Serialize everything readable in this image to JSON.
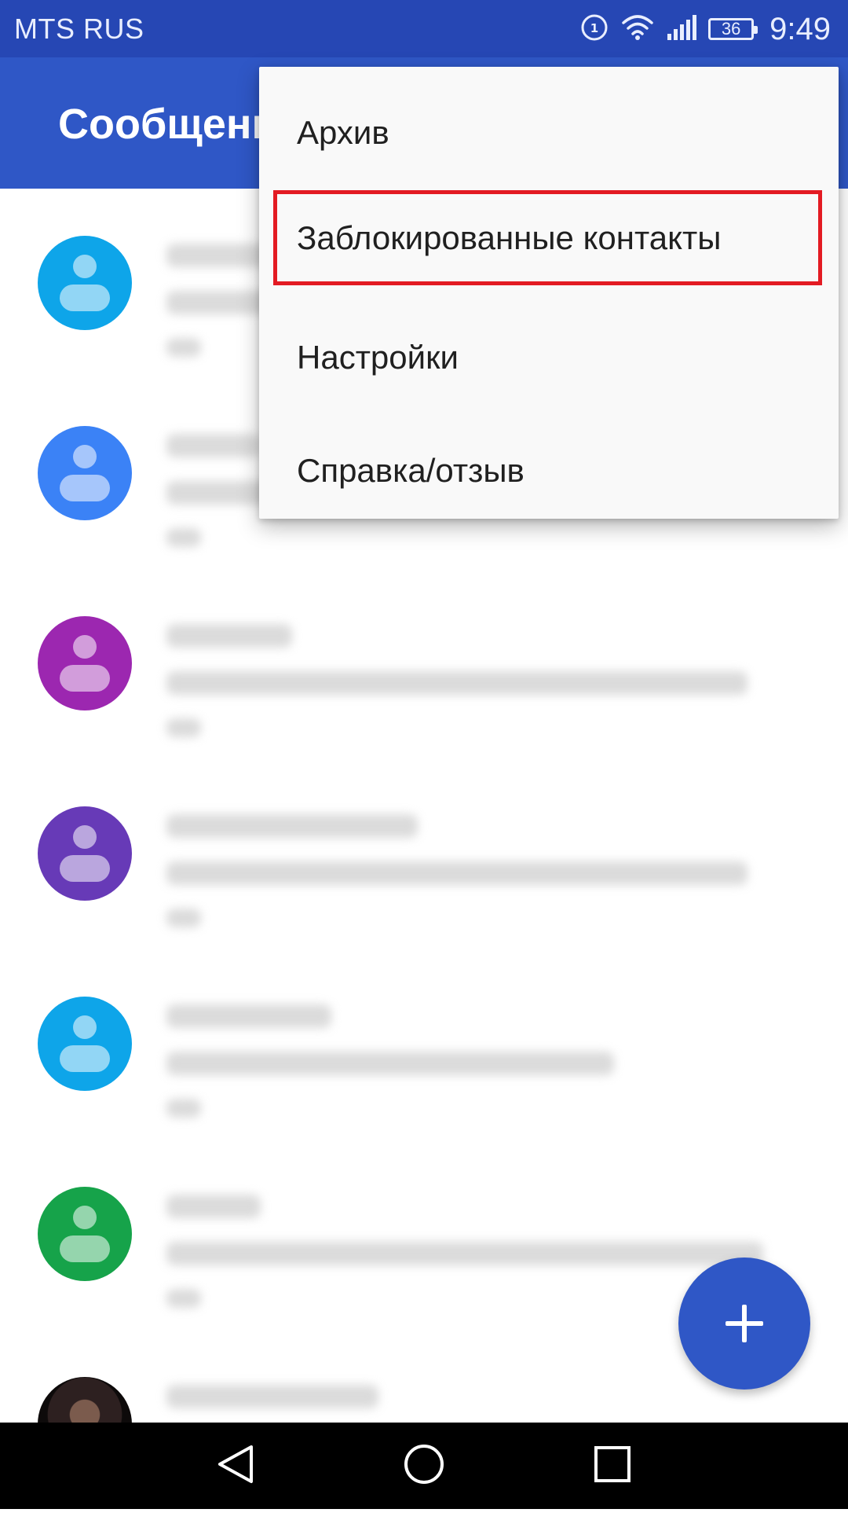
{
  "status_bar": {
    "carrier": "MTS RUS",
    "battery": "36",
    "time": "9:49"
  },
  "app_bar": {
    "title": "Сообщения"
  },
  "conversations": [
    {
      "avatar_color": "#0ea5e9"
    },
    {
      "avatar_color": "#3b82f6"
    },
    {
      "avatar_color": "#9c27b0"
    },
    {
      "avatar_color": "#673ab7"
    },
    {
      "avatar_color": "#0ea5e9"
    },
    {
      "avatar_color": "#16a34a"
    },
    {
      "avatar_color": "photo"
    }
  ],
  "overflow_menu": {
    "items": [
      {
        "label": "Архив"
      },
      {
        "label": "Заблокированные контакты"
      },
      {
        "label": "Настройки"
      },
      {
        "label": "Справка/отзыв"
      }
    ],
    "highlight_color": "#e31b23"
  },
  "colors": {
    "status_bar": "#2647b4",
    "app_bar": "#2f57c6",
    "fab": "#2f57c6"
  },
  "icons": {
    "fab": "plus-icon",
    "nav_back": "back-icon",
    "nav_home": "home-icon",
    "nav_recents": "recents-icon"
  }
}
